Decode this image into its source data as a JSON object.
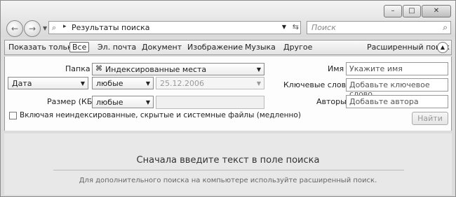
{
  "address": {
    "path_icon": "search-icon",
    "crumb_separator": "▸",
    "location": "Результаты поиска"
  },
  "search": {
    "placeholder": "Поиск"
  },
  "filterbar": {
    "label": "Показать только:",
    "items": [
      "Все",
      "Эл. почта",
      "Документ",
      "Изображение",
      "Музыка",
      "Другое"
    ],
    "selected": "Все",
    "advanced": "Расширенный поиск"
  },
  "advanced": {
    "folder_label": "Папка",
    "folder_value": "Индексированные места",
    "date_field": "Дата",
    "date_condition": "любые",
    "date_value": "25.12.2006",
    "size_label": "Размер (КБ)",
    "size_condition": "любые",
    "name_label": "Имя",
    "name_placeholder": "Укажите имя",
    "tags_label": "Ключевые слова",
    "tags_placeholder": "Добавьте ключевое слово",
    "authors_label": "Авторы",
    "authors_placeholder": "Добавьте автора",
    "include_nonindexed": "Включая неиндексированные, скрытые и системные файлы (медленно)",
    "find_button": "Найти"
  },
  "content": {
    "prompt": "Сначала введите текст в поле поиска",
    "hint": "Для дополнительного поиска на компьютере используйте расширенный поиск."
  }
}
